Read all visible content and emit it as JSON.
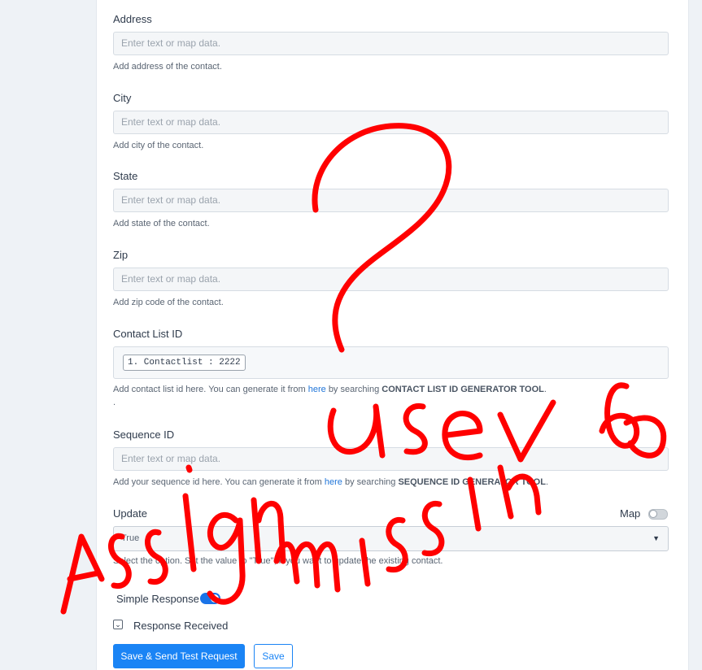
{
  "form": {
    "address": {
      "label": "Address",
      "placeholder": "Enter text or map data.",
      "help": "Add address of the contact."
    },
    "city": {
      "label": "City",
      "placeholder": "Enter text or map data.",
      "help": "Add city of the contact."
    },
    "state": {
      "label": "State",
      "placeholder": "Enter text or map data.",
      "help": "Add state of the contact."
    },
    "zip": {
      "label": "Zip",
      "placeholder": "Enter text or map data.",
      "help": "Add zip code of the contact."
    },
    "contact_list": {
      "label": "Contact List ID",
      "token": "1. Contactlist : 2222",
      "help_prefix": "Add contact list id here. You can generate it from",
      "help_link": "here",
      "help_middle": "by searching",
      "help_strong": "CONTACT LIST ID GENERATOR TOOL",
      "help_suffix": ".",
      "extra": "."
    },
    "sequence": {
      "label": "Sequence ID",
      "placeholder": "Enter text or map data.",
      "help_prefix": "Add your sequence id here. You can generate it from",
      "help_link": "here",
      "help_middle": "by searching",
      "help_strong": "SEQUENCE ID GENERATOR TOOL",
      "help_suffix": "."
    },
    "update": {
      "label": "Update",
      "map_label": "Map",
      "value": "True",
      "help": "Select the option. Set the value to \"True\", if you want to update the existing contact."
    },
    "simple_response": {
      "label": "Simple Response",
      "enabled": true
    },
    "response_received": {
      "label": "Response Received",
      "chevron": "⌄"
    }
  },
  "buttons": {
    "save_send": "Save & Send Test Request",
    "save": "Save"
  },
  "annotation": {
    "color": "#ff0000"
  }
}
